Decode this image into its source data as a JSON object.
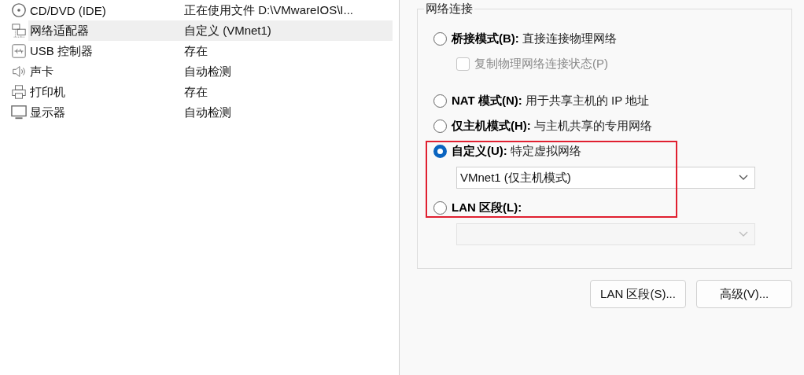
{
  "devices": [
    {
      "name": "CD/DVD (IDE)",
      "summary": "正在使用文件 D:\\VMwareIOS\\I...",
      "selected": false
    },
    {
      "name": "网络适配器",
      "summary": "自定义 (VMnet1)",
      "selected": true
    },
    {
      "name": "USB 控制器",
      "summary": "存在",
      "selected": false
    },
    {
      "name": "声卡",
      "summary": "自动检测",
      "selected": false
    },
    {
      "name": "打印机",
      "summary": "存在",
      "selected": false
    },
    {
      "name": "显示器",
      "summary": "自动检测",
      "selected": false
    }
  ],
  "network_connection": {
    "title": "网络连接",
    "options": [
      {
        "kind": "radio",
        "label": "**桥接模式(B):** 直接连接物理网络",
        "selected": false
      },
      {
        "kind": "checkbox",
        "label": "复制物理网络连接状态(P)",
        "checked": false,
        "disabled": true
      },
      {
        "kind": "radio",
        "label": "**NAT 模式(N):** 用于共享主机的 IP 地址",
        "selected": false
      },
      {
        "kind": "radio",
        "label": "**仅主机模式(H):** 与主机共享的专用网络",
        "selected": false
      },
      {
        "kind": "radio",
        "label": "**自定义(U):** 特定虚拟网络",
        "selected": true
      },
      {
        "kind": "select",
        "value": "VMnet1 (仅主机模式)",
        "disabled": false
      },
      {
        "kind": "radio",
        "label": "**LAN 区段(L):**",
        "selected": false
      },
      {
        "kind": "select",
        "disabled": true
      }
    ]
  },
  "buttons": [
    "LAN 区段(S)...",
    "高级(V)..."
  ]
}
